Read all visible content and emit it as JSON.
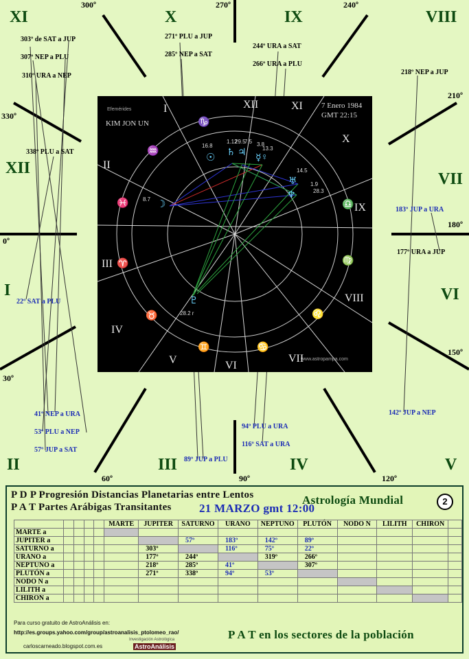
{
  "wheel": {
    "houses": {
      "xi": "XI",
      "x": "X",
      "ix": "IX",
      "viii": "VIII",
      "xii": "XII",
      "vii": "VII",
      "i": "I",
      "vi": "VI",
      "ii": "II",
      "iii": "III",
      "iv": "IV",
      "v": "V"
    },
    "degrees": {
      "d300": "300º",
      "d270": "270º",
      "d240": "240º",
      "d330": "330º",
      "d210": "210º",
      "d0": "0º",
      "d180": "180º",
      "d150": "150º",
      "d30": "30º",
      "d60": "60º",
      "d90": "90º",
      "d120": "120º"
    },
    "aspects": [
      {
        "text": "303º de SAT a JUP",
        "color": "black"
      },
      {
        "text": "307º NEP a PLU",
        "color": "black"
      },
      {
        "text": "310º URA a NEP",
        "color": "black"
      },
      {
        "text": "271º PLU a JUP",
        "color": "black"
      },
      {
        "text": "285º NEP a SAT",
        "color": "black"
      },
      {
        "text": "244º URA a SAT",
        "color": "black"
      },
      {
        "text": "266º URA a PLU",
        "color": "black"
      },
      {
        "text": "218º NEP a JUP",
        "color": "black"
      },
      {
        "text": "338º PLU a SAT",
        "color": "black"
      },
      {
        "text": "183º JUP a URA",
        "color": "blue"
      },
      {
        "text": "177º URA a JUP",
        "color": "black"
      },
      {
        "text": "22º SAT a PLU",
        "color": "blue"
      },
      {
        "text": "41º NEP a URA",
        "color": "blue"
      },
      {
        "text": "53º PLU a NEP",
        "color": "blue"
      },
      {
        "text": "57º  JUP a SAT",
        "color": "blue"
      },
      {
        "text": "89º JUP a PLU",
        "color": "blue"
      },
      {
        "text": "94º PLU a URA",
        "color": "blue"
      },
      {
        "text": "116º SAT a URA",
        "color": "blue"
      },
      {
        "text": "142º JUP a NEP",
        "color": "blue"
      }
    ]
  },
  "chart": {
    "source": "Efemérides",
    "name": "KIM JON UN",
    "date": "7 Enero 1984",
    "time": "GMT 22:15",
    "site": "www.astropampa.com",
    "houses": [
      "I",
      "II",
      "III",
      "IV",
      "V",
      "VI",
      "VII",
      "VIII",
      "IX",
      "X",
      "XI",
      "XII"
    ],
    "numbers": {
      "n168": "16.8",
      "n87": "8.7",
      "n112": "1.12",
      "n295": "29.5",
      "n75": "7.5",
      "n38": "3.8",
      "n133": "13.3",
      "n145": "14.5",
      "n19": "1.9",
      "n283": "28.3",
      "n282": "28.2 r"
    }
  },
  "panel": {
    "line1": "P D P  Progresión Distancias Planetarias entre Lentos",
    "line2": "P A T  Partes Arábigas Transitantes",
    "date": "21 MARZO gmt 12:00",
    "title": "Astrología  Mundial",
    "badge": "2",
    "footer1": "Para curso gratuito de AstroAnálisis en:",
    "footer2": "http://es.groups.yahoo.com/group/astroanalisis_ptolomeo_rao/",
    "footer3": "carloscarneado.blogspot.com.es",
    "logo_top": "Investigación Astrológica",
    "logo": "AstroAnálisis",
    "footer_big": "P A T  en los sectores de la población"
  },
  "table": {
    "headers": [
      "MARTE",
      "JUPITER",
      "SATURNO",
      "URANO",
      "NEPTUNO",
      "PLUTÓN",
      "NODO N",
      "LILITH",
      "CHIRON"
    ],
    "rows": [
      {
        "label": "MARTE a",
        "cells": [
          "",
          "",
          "",
          "",
          "",
          "",
          "",
          "",
          ""
        ]
      },
      {
        "label": "JUPITER a",
        "cells": [
          "",
          "",
          "57º",
          "183º",
          "142º",
          "89º",
          "",
          "",
          ""
        ]
      },
      {
        "label": "SATURNO a",
        "cells": [
          "",
          "303º",
          "",
          "116º",
          "75º",
          "22º",
          "",
          "",
          ""
        ]
      },
      {
        "label": "URANO a",
        "cells": [
          "",
          "177º",
          "244º",
          "",
          "319º",
          "266º",
          "",
          "",
          ""
        ]
      },
      {
        "label": "NEPTUNO a",
        "cells": [
          "",
          "218º",
          "285º",
          "41º",
          "",
          "307º",
          "",
          "",
          ""
        ]
      },
      {
        "label": "PLUTÓN a",
        "cells": [
          "",
          "271º",
          "338º",
          "94º",
          "53º",
          "",
          "",
          "",
          ""
        ]
      },
      {
        "label": "NODO N a",
        "cells": [
          "",
          "",
          "",
          "",
          "",
          "",
          "",
          "",
          ""
        ]
      },
      {
        "label": "LILITH a",
        "cells": [
          "",
          "",
          "",
          "",
          "",
          "",
          "",
          "",
          ""
        ]
      },
      {
        "label": "CHIRON a",
        "cells": [
          "",
          "",
          "",
          "",
          "",
          "",
          "",
          "",
          ""
        ]
      }
    ],
    "blue_cells": [
      [
        1,
        2
      ],
      [
        1,
        3
      ],
      [
        1,
        4
      ],
      [
        1,
        5
      ],
      [
        2,
        3
      ],
      [
        2,
        4
      ],
      [
        2,
        5
      ],
      [
        4,
        3
      ],
      [
        5,
        3
      ],
      [
        5,
        4
      ]
    ]
  }
}
